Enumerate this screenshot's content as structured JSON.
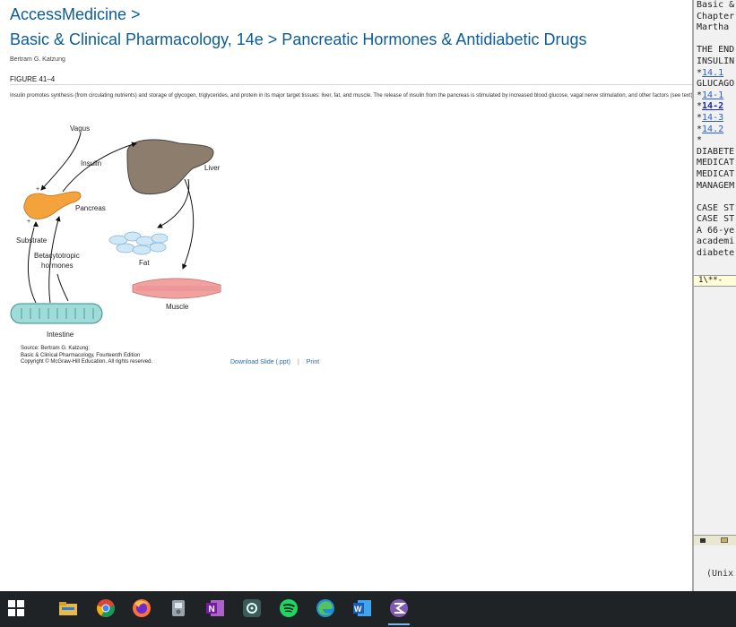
{
  "article": {
    "breadcrumb": "AccessMedicine >",
    "title": "Basic & Clinical Pharmacology, 14e > Pancreatic Hormones & Antidiabetic Drugs",
    "author": "Bertram G. Katzung",
    "figure_label": "FIGURE 41–4",
    "caption": "Insulin promotes synthesis (from circulating nutrients) and storage of glycogen, triglycerides, and protein in its major target tissues: liver, fat, and muscle. The release of insulin from the pancreas is stimulated by increased blood glucose, vagal nerve stimulation, and other factors (see text).",
    "figure": {
      "labels": {
        "vagus": "Vagus",
        "insulin": "Insulin",
        "liver": "Liver",
        "pancreas": "Pancreas",
        "substrate": "Substrate",
        "betacytotropic": "Betacytotropic",
        "hormones": "hormones",
        "fat": "Fat",
        "muscle": "Muscle",
        "intestine": "Intestine",
        "plus": "+"
      },
      "colors": {
        "liver": "#8d7d6d",
        "pancreas": "#f4a23b",
        "fat": "#cfe7f7",
        "muscle": "#f2a0a0",
        "intestine": "#9fdcd9"
      }
    },
    "source_lines": [
      "Source: Bertram G. Katzung:",
      "Basic & Clinical Pharmacology, Fourteenth Edition",
      "Copyright © McGraw-Hill Education. All rights reserved."
    ],
    "actions": {
      "download": "Download Slide (.ppt)",
      "separator": "|",
      "print": "Print"
    }
  },
  "editor": {
    "lines": [
      {
        "text": "Basic &"
      },
      {
        "text": "Chapter"
      },
      {
        "text": "Martha"
      },
      {
        "text": ""
      },
      {
        "text": "THE END"
      },
      {
        "text": "INSULIN"
      },
      {
        "prefix": "*",
        "link": "14.1"
      },
      {
        "text": "GLUCAGO"
      },
      {
        "prefix": "*",
        "link": "14-1"
      },
      {
        "prefix": "*",
        "link": "14-2",
        "bold": true
      },
      {
        "prefix": "*",
        "link": "14-3"
      },
      {
        "prefix": "*",
        "link": "14.2"
      },
      {
        "text": "*"
      },
      {
        "text": "DIABETE"
      },
      {
        "text": "MEDICAT"
      },
      {
        "text": "MEDICAT"
      },
      {
        "text": "MANAGEM"
      },
      {
        "text": ""
      },
      {
        "text": "CASE ST"
      },
      {
        "text": "CASE ST"
      },
      {
        "text": "A 66-ye"
      },
      {
        "text": "academi"
      },
      {
        "text": "diabete"
      }
    ],
    "mode_line": "1\\**-",
    "minibuffer": "(Unix"
  },
  "taskbar": {
    "items": [
      {
        "name": "start-button",
        "icon": "windows-icon"
      },
      {
        "name": "file-explorer",
        "icon": "folder-icon"
      },
      {
        "name": "chrome",
        "icon": "chrome-icon"
      },
      {
        "name": "firefox",
        "icon": "firefox-icon"
      },
      {
        "name": "app-generic",
        "icon": "app-icon"
      },
      {
        "name": "onenote",
        "icon": "onenote-icon",
        "letter": "N"
      },
      {
        "name": "settings-app",
        "icon": "gear-icon"
      },
      {
        "name": "spotify",
        "icon": "spotify-icon"
      },
      {
        "name": "edge",
        "icon": "edge-icon"
      },
      {
        "name": "word",
        "icon": "word-icon",
        "letter": "W"
      },
      {
        "name": "emacs",
        "icon": "emacs-icon",
        "active": true
      }
    ]
  }
}
